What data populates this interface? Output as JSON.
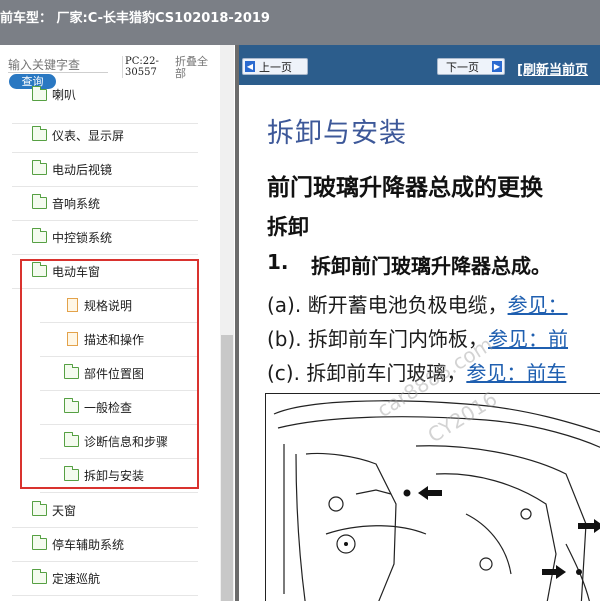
{
  "window": {
    "title": "前车型：  厂家:C-长丰猎豹CS102018-2019"
  },
  "search": {
    "placeholder": "输入关键字查",
    "button": "查询"
  },
  "sidebar": {
    "pc_code": "PC:22-30557",
    "collapse_all": "折叠全部",
    "items": [
      {
        "label": "喇叭",
        "level": 1,
        "icon": "folder-icon"
      },
      {
        "label": "仪表、显示屏",
        "level": 1,
        "icon": "folder-icon"
      },
      {
        "label": "电动后视镜",
        "level": 1,
        "icon": "folder-icon"
      },
      {
        "label": "音响系统",
        "level": 1,
        "icon": "folder-icon"
      },
      {
        "label": "中控锁系统",
        "level": 1,
        "icon": "folder-icon"
      },
      {
        "label": "电动车窗",
        "level": 1,
        "icon": "folder-open-icon"
      },
      {
        "label": "规格说明",
        "level": 2,
        "icon": "document-icon"
      },
      {
        "label": "描述和操作",
        "level": 2,
        "icon": "document-icon"
      },
      {
        "label": "部件位置图",
        "level": 2,
        "icon": "folder-icon"
      },
      {
        "label": "一般检查",
        "level": 2,
        "icon": "folder-icon"
      },
      {
        "label": "诊断信息和步骤",
        "level": 2,
        "icon": "folder-icon"
      },
      {
        "label": "拆卸与安装",
        "level": 2,
        "icon": "folder-icon"
      },
      {
        "label": "天窗",
        "level": 1,
        "icon": "folder-icon"
      },
      {
        "label": "停车辅助系统",
        "level": 1,
        "icon": "folder-icon"
      },
      {
        "label": "定速巡航",
        "level": 1,
        "icon": "folder-icon"
      }
    ]
  },
  "nav": {
    "prev": "上一页",
    "next": "下一页",
    "refresh": "[刷新当前页"
  },
  "doc": {
    "heading": "拆卸与安装",
    "title": "前门玻璃升降器总成的更换",
    "section": "拆卸",
    "step_number": "1.",
    "step_text": "拆卸前门玻璃升降器总成。",
    "substeps": [
      {
        "prefix": "(a). 断开蓄电池负极电缆，",
        "link": "参见："
      },
      {
        "prefix": "(b). 拆卸前车门内饰板，",
        "link": "参见：前"
      },
      {
        "prefix": "(c). 拆卸前车门玻璃，",
        "link": "参见：前车"
      }
    ],
    "watermarks": [
      "car8888.com",
      "CY2016"
    ]
  },
  "colors": {
    "accent": "#2c5d8c",
    "highlight": "#d9322e",
    "heading": "#3d5899",
    "folder": "#56a043"
  }
}
